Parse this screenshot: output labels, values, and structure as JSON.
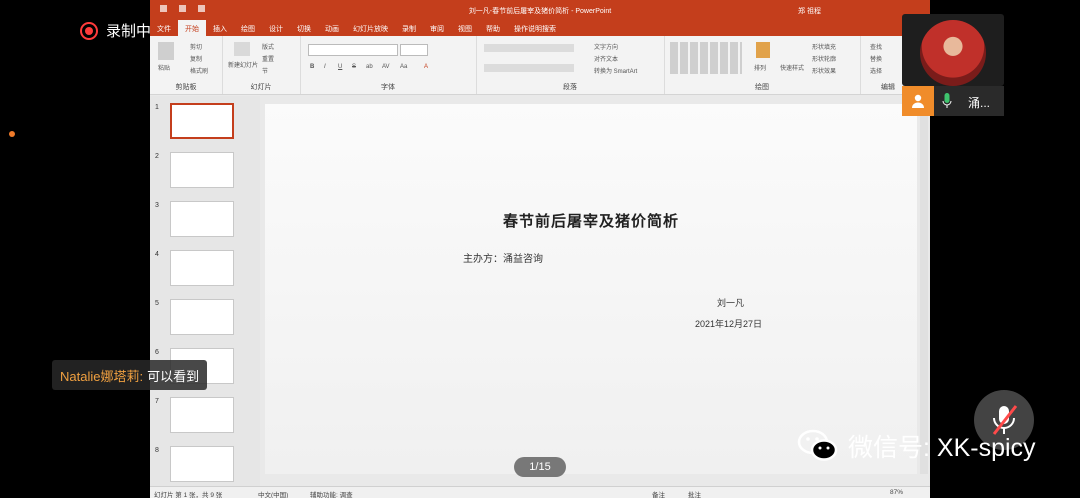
{
  "recording": {
    "label": "录制中"
  },
  "powerpoint": {
    "window_title": "刘一凡-春节前后屠宰及猪价简析 - PowerPoint",
    "user_name": "郑 祖程",
    "tabs": [
      "文件",
      "开始",
      "插入",
      "绘图",
      "设计",
      "切换",
      "动画",
      "幻灯片放映",
      "录制",
      "审阅",
      "视图",
      "帮助",
      "操作说明搜索"
    ],
    "active_tab": "开始",
    "ribbon_groups": [
      {
        "name": "剪贴板",
        "items": [
          "剪切",
          "复制",
          "格式刷",
          "粘贴"
        ]
      },
      {
        "name": "幻灯片",
        "items": [
          "新建幻灯片",
          "版式",
          "重置",
          "节"
        ]
      },
      {
        "name": "字体",
        "items": [
          "B",
          "I",
          "U",
          "S",
          "ab",
          "AV",
          "Aa",
          "A"
        ]
      },
      {
        "name": "段落",
        "items": [
          "文字方向",
          "对齐文本",
          "转换为 SmartArt"
        ]
      },
      {
        "name": "绘图",
        "items": [
          "排列",
          "快速样式",
          "形状填充",
          "形状轮廓",
          "形状效果"
        ]
      },
      {
        "name": "编辑",
        "items": [
          "查找",
          "替换",
          "选择"
        ]
      }
    ],
    "thumbnails": [
      {
        "num": "1"
      },
      {
        "num": "2"
      },
      {
        "num": "3"
      },
      {
        "num": "4"
      },
      {
        "num": "5"
      },
      {
        "num": "6"
      },
      {
        "num": "7"
      },
      {
        "num": "8"
      }
    ],
    "slide": {
      "title": "春节前后屠宰及猪价简析",
      "organizer": "主办方：涌益咨询",
      "author": "刘一凡",
      "date": "2021年12月27日"
    },
    "page_indicator": "1/15",
    "status": {
      "slide_info": "幻灯片 第 1 张，共 9 张",
      "language": "中文(中国)",
      "accessibility": "辅助功能: 调查",
      "notes": "备注",
      "comments": "批注",
      "zoom": "87%"
    }
  },
  "participant": {
    "name": "涌..."
  },
  "chat": {
    "sender": "Natalie娜塔莉:",
    "message": "可以看到"
  },
  "watermark": {
    "text": "微信号: XK-spicy"
  },
  "colors": {
    "ppt_accent": "#c43e1c",
    "record_red": "#ff3b3b",
    "orange": "#f08c2a"
  }
}
